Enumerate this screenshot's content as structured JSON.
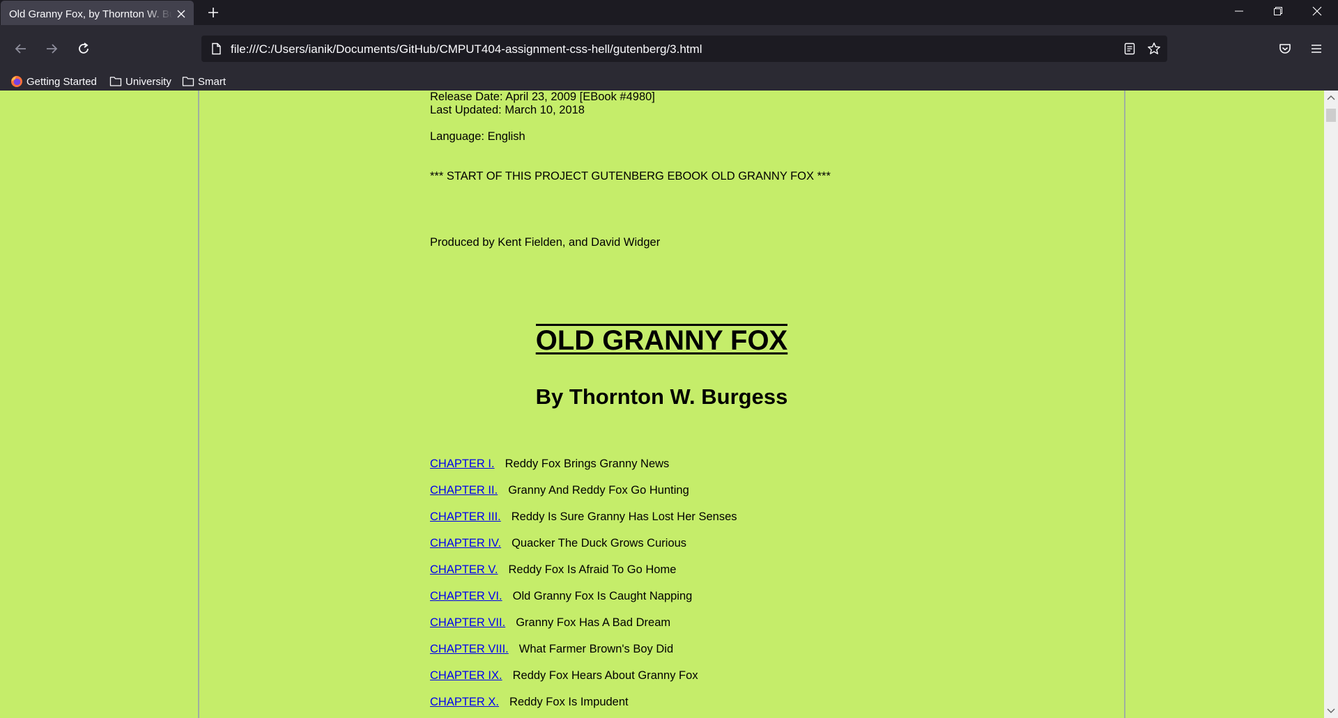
{
  "browser": {
    "tab_title": "Old Granny Fox, by Thornton W. Burgess",
    "url": "file:///C:/Users/ianik/Documents/GitHub/CMPUT404-assignment-css-hell/gutenberg/3.html",
    "bookmarks": [
      {
        "label": "Getting Started",
        "icon": "firefox-icon"
      },
      {
        "label": "University",
        "icon": "folder-icon"
      },
      {
        "label": "Smart",
        "icon": "folder-icon"
      }
    ]
  },
  "page": {
    "release_date": "Release Date: April 23, 2009 [EBook #4980]",
    "last_updated": "Last Updated: March 10, 2018",
    "language": "Language: English",
    "start_marker": "*** START OF THIS PROJECT GUTENBERG EBOOK OLD GRANNY FOX ***",
    "produced_by": "Produced by Kent Fielden, and David Widger",
    "title": "OLD GRANNY FOX",
    "author": "By Thornton W. Burgess",
    "toc": [
      {
        "chapter": "CHAPTER I.",
        "title": "Reddy Fox Brings Granny News"
      },
      {
        "chapter": "CHAPTER II.",
        "title": "Granny And Reddy Fox Go Hunting"
      },
      {
        "chapter": "CHAPTER III.",
        "title": "Reddy Is Sure Granny Has Lost Her Senses"
      },
      {
        "chapter": "CHAPTER IV.",
        "title": "Quacker The Duck Grows Curious"
      },
      {
        "chapter": "CHAPTER V.",
        "title": "Reddy Fox Is Afraid To Go Home"
      },
      {
        "chapter": "CHAPTER VI.",
        "title": "Old Granny Fox Is Caught Napping"
      },
      {
        "chapter": "CHAPTER VII.",
        "title": "Granny Fox Has A Bad Dream"
      },
      {
        "chapter": "CHAPTER VIII.",
        "title": "What Farmer Brown's Boy Did"
      },
      {
        "chapter": "CHAPTER IX.",
        "title": "Reddy Fox Hears About Granny Fox"
      },
      {
        "chapter": "CHAPTER X.",
        "title": "Reddy Fox Is Impudent"
      }
    ]
  },
  "colors": {
    "page_background": "#c5ed6a",
    "link": "#0000ee",
    "chrome_dark": "#1c1b22",
    "chrome_toolbar": "#2b2a33"
  }
}
